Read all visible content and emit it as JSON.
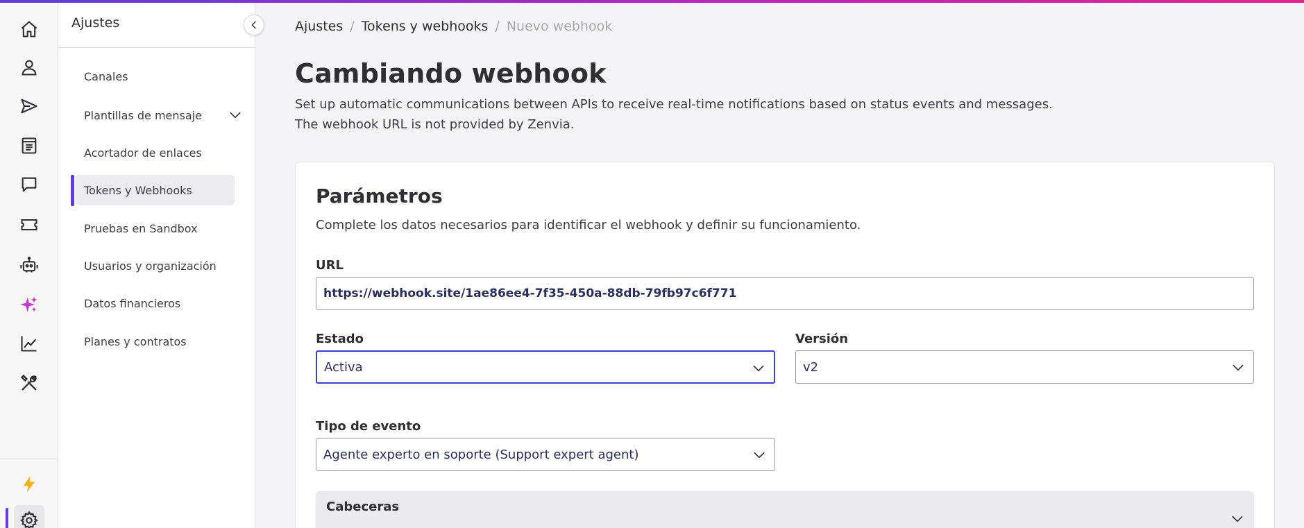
{
  "colors": {
    "accent": "#5b3fd6",
    "gradient_start": "#5b3fd6",
    "gradient_end": "#e0248a",
    "focus_border": "#3a3fd0",
    "spark": "#c13cc7",
    "bolt": "#f2b318"
  },
  "rail": {
    "items": [
      {
        "icon": "home-icon"
      },
      {
        "icon": "user-icon"
      },
      {
        "icon": "send-icon"
      },
      {
        "icon": "document-icon"
      },
      {
        "icon": "chat-icon"
      },
      {
        "icon": "ticket-icon"
      },
      {
        "icon": "robot-icon"
      },
      {
        "icon": "sparkles-icon"
      },
      {
        "icon": "chart-icon"
      },
      {
        "icon": "tools-icon"
      }
    ],
    "bottom": [
      {
        "icon": "bolt-icon"
      },
      {
        "icon": "gear-icon"
      }
    ]
  },
  "sidebar": {
    "title": "Ajustes",
    "items": [
      {
        "label": "Canales"
      },
      {
        "label": "Plantillas de mensaje"
      },
      {
        "label": "Acortador de enlaces"
      },
      {
        "label": "Tokens y Webhooks"
      },
      {
        "label": "Pruebas en Sandbox"
      },
      {
        "label": "Usuarios y organización"
      },
      {
        "label": "Datos financieros"
      },
      {
        "label": "Planes y contratos"
      }
    ]
  },
  "breadcrumb": {
    "items": [
      "Ajustes",
      "Tokens y webhooks",
      "Nuevo webhook"
    ],
    "separator": "/"
  },
  "page": {
    "title": "Cambiando webhook",
    "description_line1": "Set up automatic communications between APIs to receive real-time notifications based on status events and messages.",
    "description_line2": "The webhook URL is not provided by Zenvia."
  },
  "params": {
    "title": "Parámetros",
    "subtitle": "Complete los datos necesarios para identificar el webhook y definir su funcionamiento.",
    "url_label": "URL",
    "url_value": "https://webhook.site/1ae86ee4-7f35-450a-88db-79fb97c6f771",
    "estado_label": "Estado",
    "estado_value": "Activa",
    "version_label": "Versión",
    "version_value": "v2",
    "tipo_label": "Tipo de evento",
    "tipo_value": "Agente experto en soporte (Support expert agent)",
    "cabeceras_label": "Cabeceras"
  }
}
